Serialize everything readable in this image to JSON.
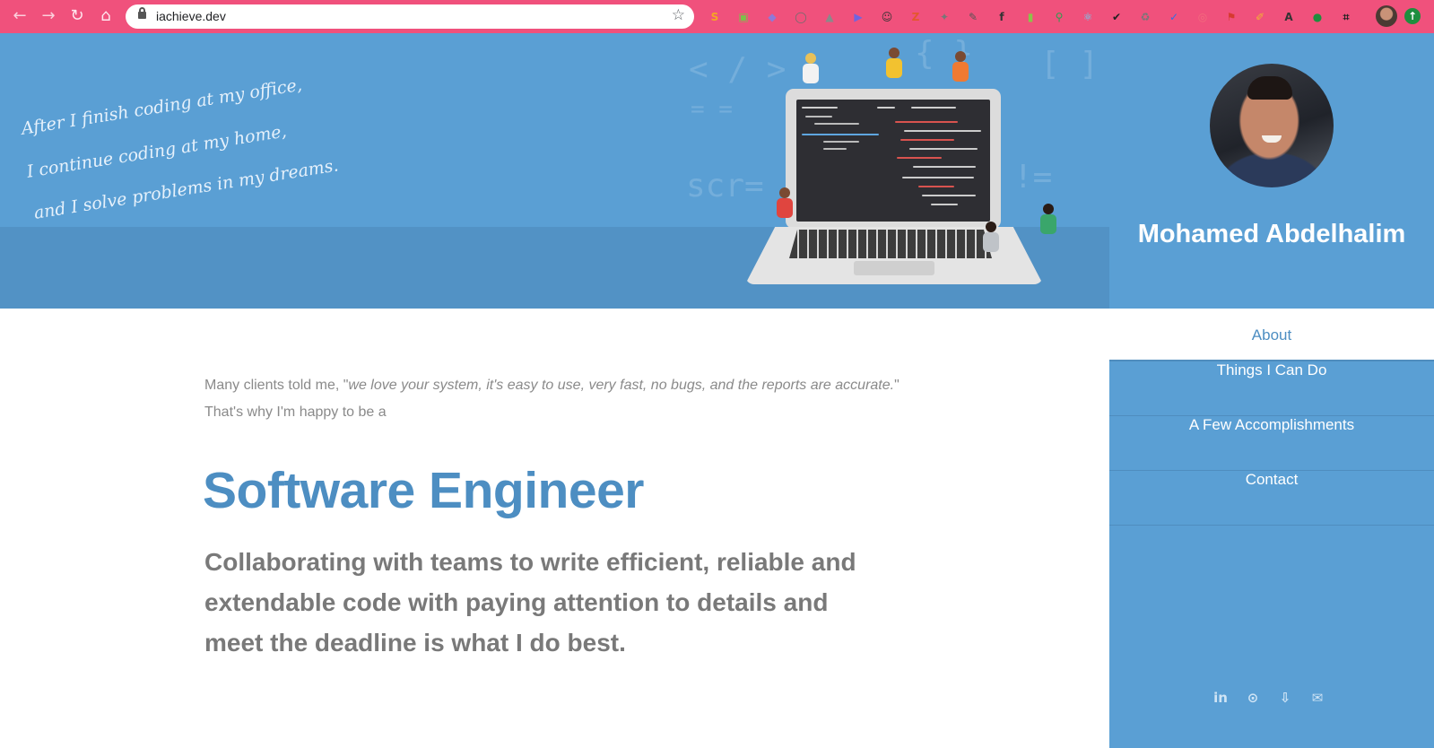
{
  "browser": {
    "url": "iachieve.dev",
    "back_icon": "arrow-left-icon",
    "forward_icon": "arrow-right-icon",
    "reload_icon": "reload-icon",
    "home_icon": "home-icon",
    "bookmark_icon": "star-icon",
    "extensions": [
      {
        "name": "extension-s-icon",
        "glyph": "S",
        "color": "#f5a623"
      },
      {
        "name": "extension-printer-icon",
        "glyph": "▣",
        "color": "#7cc04b"
      },
      {
        "name": "extension-purple-icon",
        "glyph": "◆",
        "color": "#8e79d9"
      },
      {
        "name": "extension-circle-icon",
        "glyph": "◯",
        "color": "#6d6d6d"
      },
      {
        "name": "extension-triangle-icon",
        "glyph": "▲",
        "color": "#8a8a8a"
      },
      {
        "name": "extension-play-icon",
        "glyph": "▶",
        "color": "#6f64e0"
      },
      {
        "name": "extension-ghost-icon",
        "glyph": "☺",
        "color": "#333333"
      },
      {
        "name": "extension-z-icon",
        "glyph": "Z",
        "color": "#e4572e"
      },
      {
        "name": "extension-bulb-icon",
        "glyph": "✦",
        "color": "#777777"
      },
      {
        "name": "extension-dropper-icon",
        "glyph": "✎",
        "color": "#555555"
      },
      {
        "name": "extension-fx-icon",
        "glyph": "f",
        "color": "#333333"
      },
      {
        "name": "extension-ruler-icon",
        "glyph": "▮",
        "color": "#8bc34a"
      },
      {
        "name": "extension-magnifier-icon",
        "glyph": "⚲",
        "color": "#2e9d4f"
      },
      {
        "name": "extension-react-icon",
        "glyph": "⚛",
        "color": "#61dafb"
      },
      {
        "name": "extension-checkbox-icon",
        "glyph": "✔",
        "color": "#222222"
      },
      {
        "name": "extension-recycle-icon",
        "glyph": "♻",
        "color": "#777777"
      },
      {
        "name": "extension-blue-check-icon",
        "glyph": "✓",
        "color": "#2f6fe4"
      },
      {
        "name": "extension-target-icon",
        "glyph": "◎",
        "color": "#f26d7d"
      },
      {
        "name": "extension-flag-icon",
        "glyph": "⚑",
        "color": "#d63a2f"
      },
      {
        "name": "extension-pen-icon",
        "glyph": "✐",
        "color": "#f2b134"
      },
      {
        "name": "extension-a-icon",
        "glyph": "A",
        "color": "#333333"
      },
      {
        "name": "extension-green-dot-icon",
        "glyph": "●",
        "color": "#1e8e3e"
      },
      {
        "name": "extension-crop-icon",
        "glyph": "⌗",
        "color": "#222222"
      }
    ]
  },
  "hero": {
    "quote_lines": [
      "After I finish coding at my office,",
      "I continue coding at my home,",
      "and I solve problems in my dreams."
    ]
  },
  "sidebar": {
    "name": "Mohamed Abdelhalim",
    "menu": [
      {
        "label": "About",
        "active": true
      },
      {
        "label": "Things I Can Do",
        "active": false
      },
      {
        "label": "A Few Accomplishments",
        "active": false
      },
      {
        "label": "Contact",
        "active": false
      }
    ],
    "social_icons": [
      {
        "name": "linkedin-icon",
        "glyph": "in"
      },
      {
        "name": "github-icon",
        "glyph": "⊙"
      },
      {
        "name": "resume-file-icon",
        "glyph": "⇩"
      },
      {
        "name": "email-icon",
        "glyph": "✉"
      }
    ]
  },
  "main": {
    "intro_prefix": "Many clients told me, \"",
    "intro_quote": "we love your system, it's easy to use, very fast, no bugs, and the reports are accurate.",
    "intro_suffix": "\"",
    "intro_line2": "That's why I'm happy to be a",
    "role": "Software Engineer",
    "tagline": "Collaborating with teams to write efficient, reliable and extendable code with paying attention to details and meet the deadline is what I do best."
  },
  "colors": {
    "chrome": "#f0517c",
    "accent": "#5a9fd4",
    "accent_text": "#4d8ec2",
    "muted_text": "#8a8a8a"
  }
}
